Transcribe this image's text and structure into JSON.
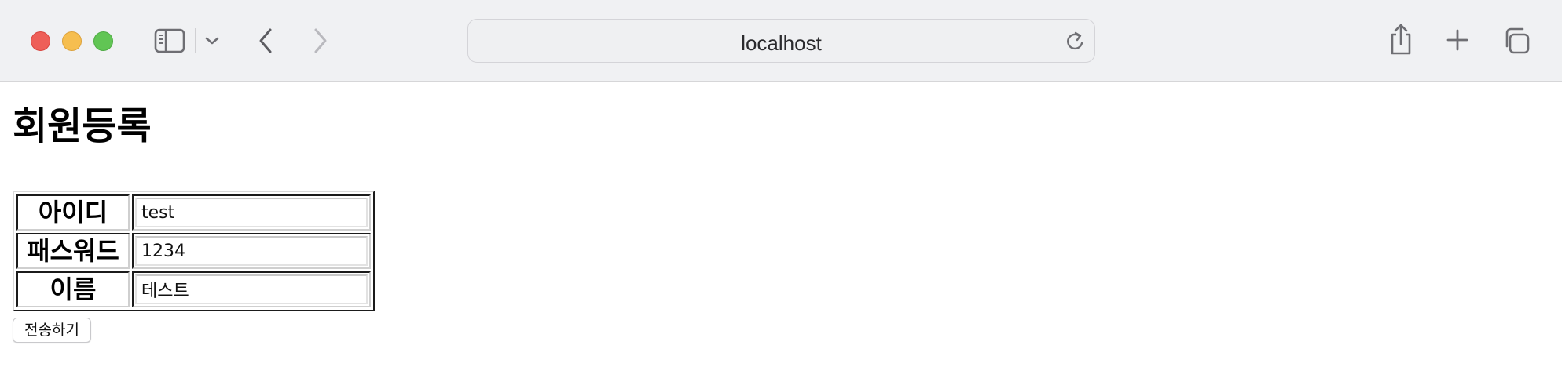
{
  "browser": {
    "url": "localhost",
    "traffic_lights": {
      "close_color": "#ee5f58",
      "minimize_color": "#f6be4f",
      "zoom_color": "#61c554"
    },
    "icons": {
      "sidebar": "sidebar-icon",
      "tab_group_menu": "chevron-down-icon",
      "back": "chevron-left-icon",
      "forward": "chevron-right-icon",
      "reload": "reload-icon",
      "share": "share-icon",
      "new_tab": "plus-icon",
      "tab_overview": "tabs-icon"
    }
  },
  "page": {
    "title": "회원등록",
    "form": {
      "rows": [
        {
          "label": "아이디",
          "value": "test"
        },
        {
          "label": "패스워드",
          "value": "1234"
        },
        {
          "label": "이름",
          "value": "테스트"
        }
      ],
      "submit_label": "전송하기"
    }
  }
}
